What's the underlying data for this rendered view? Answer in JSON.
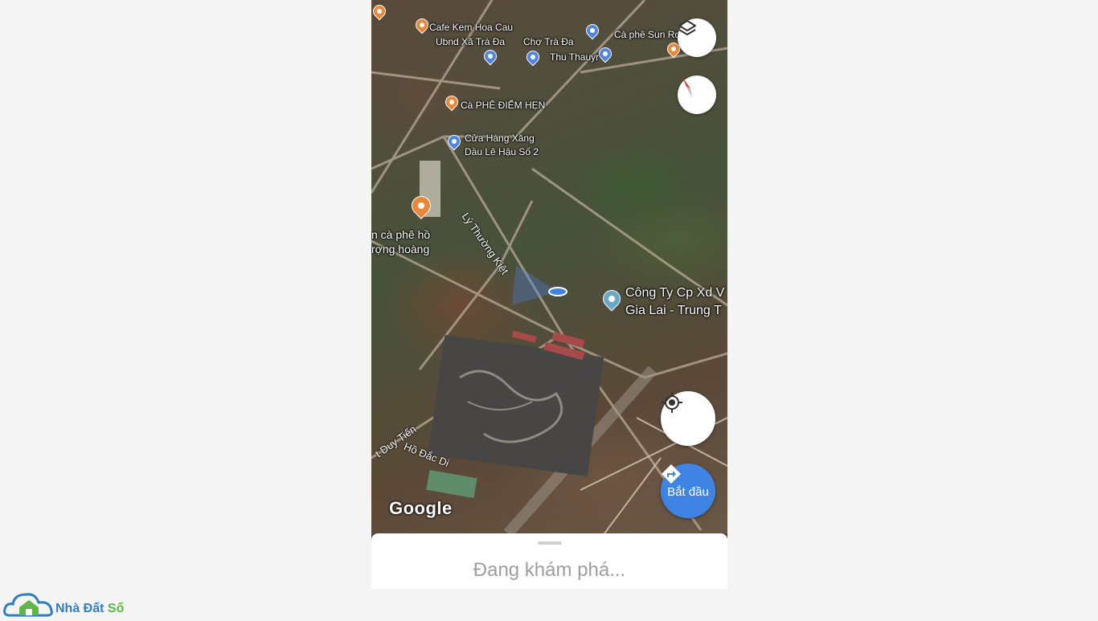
{
  "map": {
    "pois": {
      "cafe_kem": "Cafe Kem Hoa Cau",
      "ubnd": "Ubnd Xã Trà Đa",
      "cho": "Chợ Trà Đa",
      "cafe_sun": "Cà phê Sun Ros",
      "thu_thauyr": "Thu Thauyr",
      "cafe_diem_hen": "Cà PHÊ ĐIỂM HẸN",
      "cua_hang_xang_1": "Cửa Hàng Xăng",
      "cua_hang_xang_2": "Dầu Lê Hậu Số 2",
      "cafe_ho_1": "n cà phê hồ",
      "cafe_ho_2": "rợng hoàng",
      "company_1": "Công Ty Cp Xd V",
      "company_2": "Gia Lai - Trung T"
    },
    "roads": {
      "ly_thuong_kiet": "Lý Thường Kiệt",
      "duy_tien": "t Duy Tiến",
      "ho_dac_di": "Hồ Đắc Di"
    },
    "attribution": "Google"
  },
  "controls": {
    "layers_icon": "layers-icon",
    "compass_icon": "compass-icon",
    "location_icon": "my-location-icon",
    "directions_icon": "directions-icon",
    "start_label": "Bắt đầu"
  },
  "sheet": {
    "status": "Đang khám phá..."
  },
  "watermark": {
    "brand_main": "Nhà Đất",
    "brand_accent": "Số"
  },
  "colors": {
    "accent_blue": "#3f84e5",
    "poi_orange": "#e8893a",
    "poi_blue": "#4f86e0",
    "brand_blue": "#2f7ec2",
    "brand_green": "#5db846"
  }
}
